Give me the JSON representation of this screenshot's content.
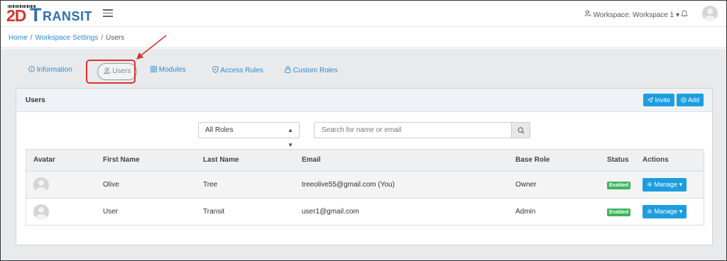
{
  "app": {
    "logo_prefix": "2D",
    "logo_t": "T",
    "logo_rest": "RANSIT",
    "workspace_label": "Workspace: Workspace 1",
    "accent_color": "#1c9ddf"
  },
  "breadcrumb": {
    "home": "Home",
    "settings": "Workspace Settings",
    "current": "Users",
    "sep": "/"
  },
  "tabs": {
    "information": "Information",
    "users": "Users",
    "modules": "Modules",
    "access_rules": "Access Rules",
    "custom_roles": "Custom Roles"
  },
  "card": {
    "title": "Users",
    "invite_label": "Invite",
    "add_label": "Add"
  },
  "filters": {
    "role_select_value": "All Roles",
    "search_placeholder": "Search for name or email"
  },
  "table": {
    "columns": [
      "Avatar",
      "First Name",
      "Last Name",
      "Email",
      "Base Role",
      "Status",
      "Actions"
    ],
    "rows": [
      {
        "first": "Olive",
        "last": "Tree",
        "email": "treeolive55@gmail.com (You)",
        "role": "Owner",
        "status": "Enabled",
        "action": "Manage"
      },
      {
        "first": "User",
        "last": "Transit",
        "email": "user1@gmail.com",
        "role": "Admin",
        "status": "Enabled",
        "action": "Manage"
      }
    ]
  },
  "icons": {
    "info": "info-icon",
    "users": "users-icon",
    "modules": "grid-icon",
    "access": "shield-icon",
    "roles": "lock-icon",
    "invite": "send-icon",
    "add": "plus-circle-icon",
    "search": "search-icon",
    "manage": "gear-icon",
    "bell": "bell-icon"
  }
}
